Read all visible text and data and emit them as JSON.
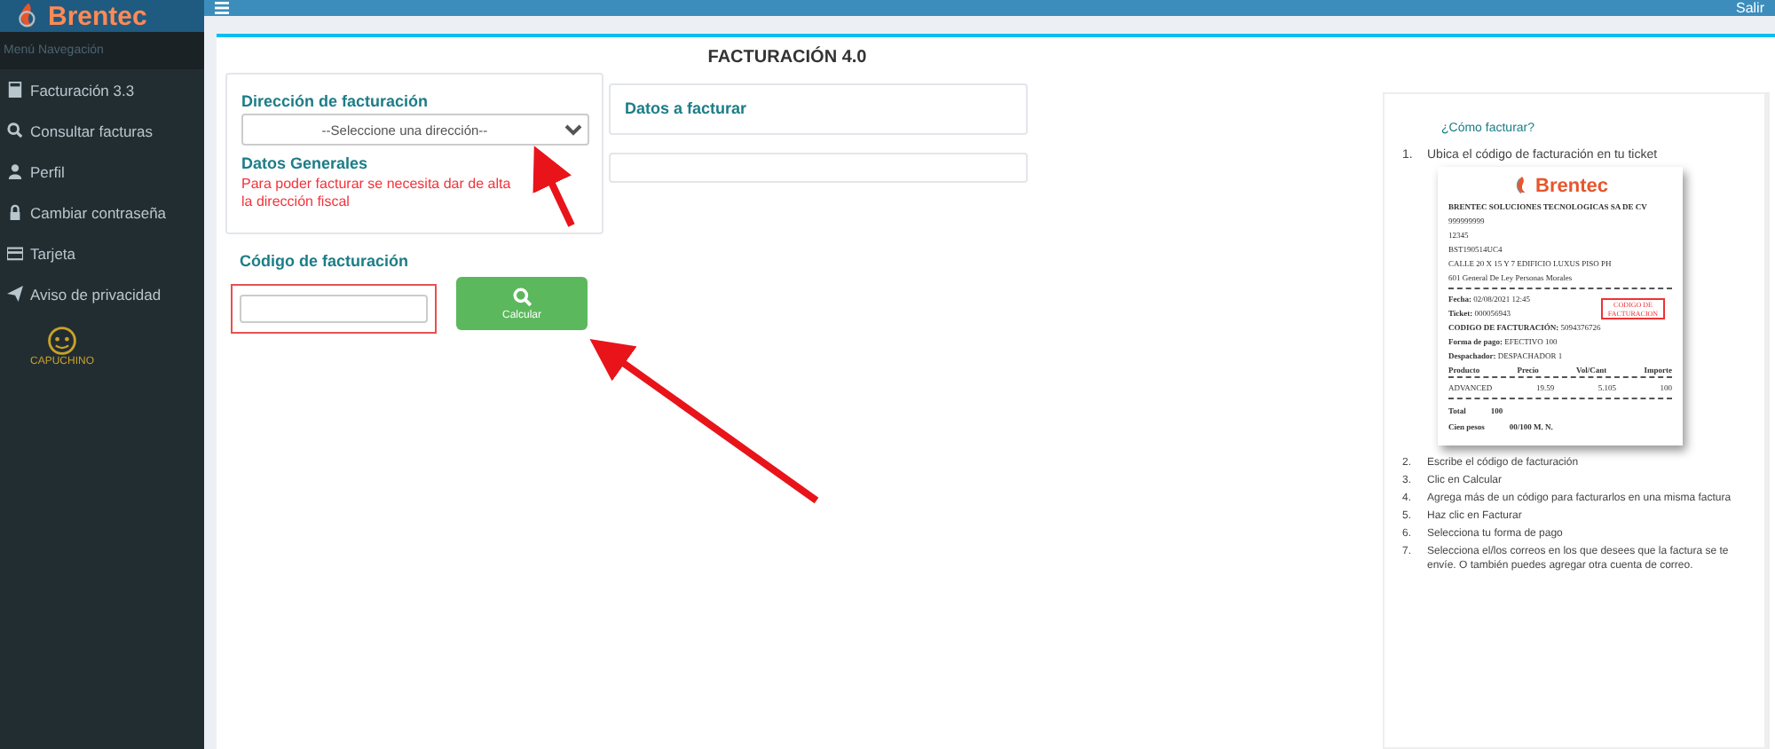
{
  "brand": {
    "name": "Brentec"
  },
  "topbar": {
    "logout": "Salir"
  },
  "sidebar": {
    "heading": "Menú Navegación",
    "items": [
      {
        "label": "Facturación 3.3"
      },
      {
        "label": "Consultar facturas"
      },
      {
        "label": "Perfil"
      },
      {
        "label": "Cambiar contraseña"
      },
      {
        "label": "Tarjeta"
      },
      {
        "label": "Aviso de privacidad"
      }
    ],
    "logo_caption": "CAPUCHINO"
  },
  "page": {
    "title": "FACTURACIÓN 4.0"
  },
  "address": {
    "label": "Dirección de facturación",
    "placeholder": "--Seleccione una dirección--"
  },
  "general": {
    "heading": "Datos Generales",
    "warning": "Para poder facturar se necesita dar de alta la dirección fiscal"
  },
  "code": {
    "label": "Código de facturación",
    "button": "Calcular"
  },
  "invoice_data": {
    "heading": "Datos a facturar"
  },
  "help": {
    "heading": "¿Cómo facturar?",
    "step_1": {
      "num": "1.",
      "text": "Ubica el código de facturación en tu ticket"
    },
    "ticket": {
      "brand": "Brentec",
      "lines": [
        "BRENTEC SOLUCIONES TECNOLOGICAS SA DE CV",
        "999999999",
        "12345",
        "BST190514UC4",
        "CALLE 20 X 15 Y 7 EDIFICIO LUXUS PISO PH",
        "601 General De Ley Personas Morales"
      ],
      "fields": [
        {
          "label": "Fecha:",
          "value": "02/08/2021  12:45"
        },
        {
          "label": "Ticket:",
          "value": "000056943"
        },
        {
          "label": "CODIGO DE FACTURACIÓN:",
          "value": "5094376726"
        },
        {
          "label": "Forma de pago:",
          "value": "EFECTIVO         100"
        },
        {
          "label": "Despachador:",
          "value": "DESPACHADOR 1"
        }
      ],
      "callout": "CODIGO DE FACTURACION",
      "columns": [
        "Producto",
        "Precio",
        "Vol/Cant",
        "Importe"
      ],
      "row": [
        "ADVANCED",
        "19.59",
        "5.105",
        "100"
      ],
      "totals": [
        {
          "label": "Total",
          "value": "100"
        },
        {
          "label": "Cien pesos",
          "value": "00/100 M. N."
        }
      ]
    },
    "steps": [
      {
        "num": "2.",
        "text": "Escribe el código de facturación"
      },
      {
        "num": "3.",
        "text": "Clic en Calcular"
      },
      {
        "num": "4.",
        "text": "Agrega más de un código para facturarlos en una misma factura"
      },
      {
        "num": "5.",
        "text": "Haz clic en Facturar"
      },
      {
        "num": "6.",
        "text": "Selecciona tu forma de pago"
      },
      {
        "num": "7.",
        "text": "Selecciona el/los correos en los que desees que la factura se te envíe. O también puedes agregar otra cuenta de correo."
      }
    ]
  }
}
